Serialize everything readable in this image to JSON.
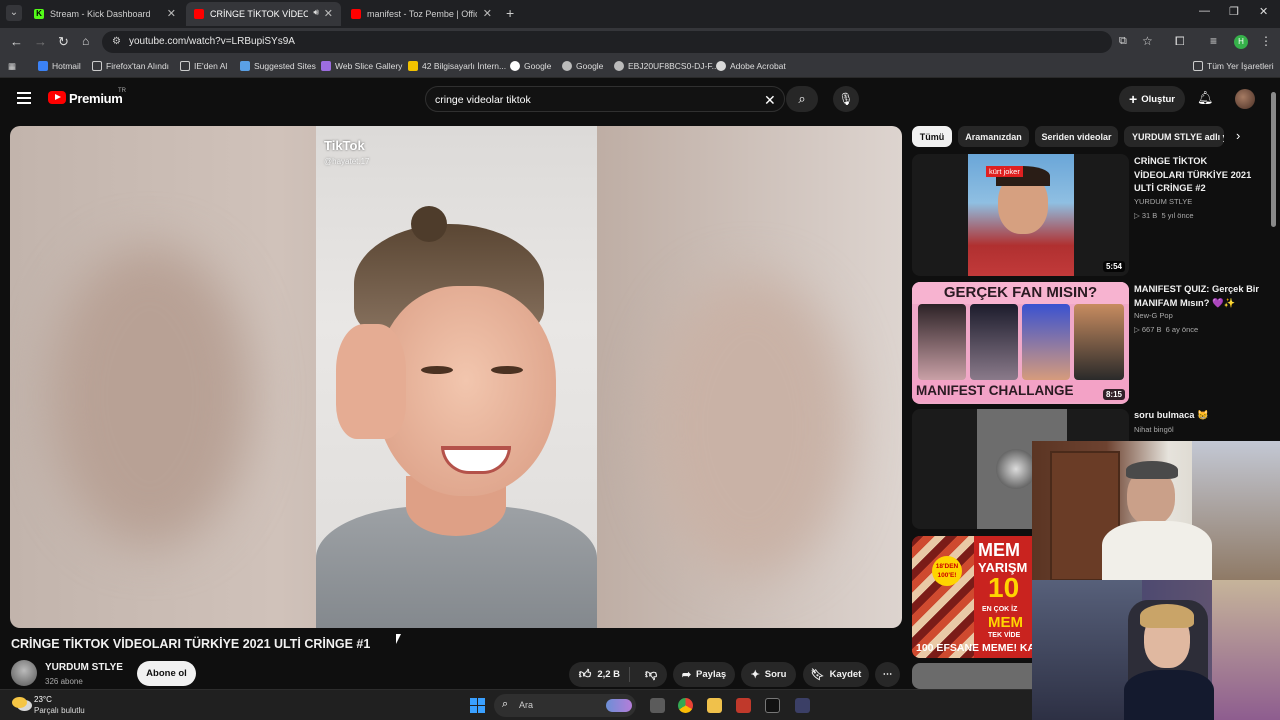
{
  "browser": {
    "tabs": [
      {
        "title": "Stream - Kick Dashboard",
        "favicon_color": "#53fc18",
        "favicon_letter": "K"
      },
      {
        "title": "CRİNGE TİKTOK VİDEOLARI",
        "favicon_color": "#ff0000"
      },
      {
        "title": "manifest - Toz Pembe | Official",
        "favicon_color": "#ff0000"
      }
    ],
    "url": "youtube.com/watch?v=LRBupiSYs9A",
    "profile_letter": "H",
    "bookmarks": [
      "Hotmail",
      "Firefox'tan Alındı",
      "IE'den Al",
      "Suggested Sites",
      "Web Slice Gallery",
      "42 Bilgisayarlı İntern...",
      "Google",
      "Google",
      "EBJ20UF8BCS0-DJ-F...",
      "Adobe Acrobat"
    ],
    "bookmarks_all": "Tüm Yer İşaretleri"
  },
  "youtube": {
    "logo_text": "Premium",
    "region": "TR",
    "search_query": "cringe videolar tiktok",
    "create_label": "Oluştur",
    "accent": "#ff0000"
  },
  "video": {
    "overlay_brand": "TikTok",
    "overlay_user": "@hayatet.17",
    "title": "CRİNGE TİKTOK VİDEOLARI TÜRKİYE 2021 ULTİ CRİNGE #1",
    "channel": "YURDUM STLYE",
    "subscribers": "326 abone",
    "subscribe_label": "Abone ol",
    "likes": "2,2 B",
    "share_label": "Paylaş",
    "ask_label": "Soru",
    "save_label": "Kaydet"
  },
  "chips": [
    "Tümü",
    "Aramanızdan",
    "Seriden videolar",
    "YURDUM STLYE adlı y"
  ],
  "recommendations": [
    {
      "title": "CRİNGE TİKTOK VİDEOLARI TÜRKİYE 2021 ULTİ CRİNGE #2",
      "channel": "YURDUM STLYE",
      "views": "31 B",
      "age": "5 yıl önce",
      "duration": "5:54",
      "thumb_label": "kürt joker"
    },
    {
      "title": "MANIFEST QUIZ: Gerçek Bir MANIFAM Mısın? 💜✨",
      "channel": "New-G Pop",
      "views": "667 B",
      "age": "6 ay önce",
      "duration": "8:15",
      "thumb_top": "GERÇEK FAN MISIN?",
      "thumb_bottom": "MANIFEST CHALLANGE"
    },
    {
      "title": "soru bulmaca 😸",
      "channel": "Nihat bingöl"
    },
    {
      "thumb_badge": "18'DEN 100'E!",
      "thumb_line1": "MEM",
      "thumb_line2": "YARIŞM",
      "thumb_number": "10",
      "thumb_sub1": "EN ÇOK İZ",
      "thumb_sub2": "MEM",
      "thumb_sub3": "TEK VİDE",
      "thumb_bottom": "100 EFSANE MEME! KA"
    }
  ],
  "taskbar": {
    "temperature": "23°C",
    "condition": "Parçalı bulutlu",
    "search_placeholder": "Ara"
  }
}
